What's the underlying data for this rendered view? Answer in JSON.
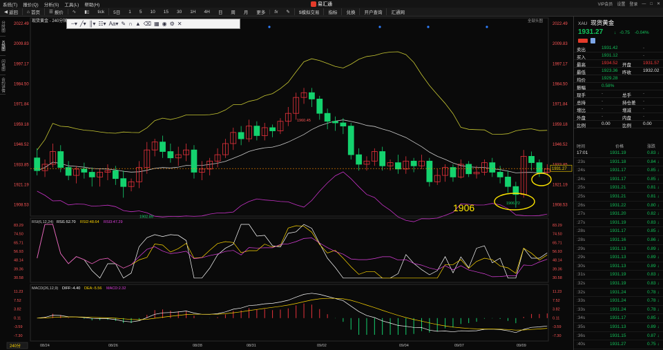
{
  "menu": [
    "系统(T)",
    "报价(Q)",
    "分析(S)",
    "工具(L)",
    "帮助(H)"
  ],
  "app_title": "易汇通",
  "window_right": [
    "VIP会员",
    "设置",
    "登录"
  ],
  "toolbar": {
    "back": "返回",
    "home": "首页",
    "quote": "报价",
    "minute": "分时",
    "tick": "tick",
    "periods": [
      "5日",
      "1",
      "5",
      "10",
      "15",
      "30",
      "1H",
      "4H",
      "日",
      "周",
      "月"
    ],
    "more": "更多",
    "fx": "fx",
    "sim_trade": "$模拟交易",
    "indicators": "指标",
    "exchange_order": "兑换",
    "account_query": "开户查询",
    "hui_tong": "汇通网"
  },
  "left_tabs": [
    "分时图",
    "K线图",
    "闪电图",
    "合约详情"
  ],
  "chart": {
    "title": "现货黄金 - 240分钟",
    "view_all": "全部头图",
    "price_scale": [
      "2022.49",
      "2009.83",
      "1997.17",
      "1984.50",
      "1971.84",
      "1959.18",
      "1946.52",
      "1933.85",
      "1921.19",
      "1908.53"
    ],
    "current_price": "1931.27",
    "high_label": "1960.45",
    "low_label": "1902.89",
    "low2_label": "1906.72",
    "annotation": "1906",
    "dates": [
      "08/24",
      "08/26",
      "08/28",
      "08/31",
      "09/02",
      "09/04",
      "09/07",
      "09/09"
    ],
    "rsi_title": "RSI(6,12,24)",
    "rsi_vals": [
      "RSI1:52.70",
      "RSI2:48.64",
      "RSI3:47.29"
    ],
    "rsi_scale": [
      "83.29",
      "74.50",
      "65.71",
      "56.93",
      "48.14",
      "39.36",
      "30.58"
    ],
    "macd_title": "MACD(26,12,9)",
    "macd_vals": [
      "DIFF:-4.40",
      "DEA:-5.56",
      "MACD:2.32"
    ],
    "macd_scale": [
      "11.23",
      "7.52",
      "3.82",
      "0.11",
      "-3.59",
      "-7.30"
    ],
    "period_tag": "240分"
  },
  "chart_data": {
    "type": "candlestick",
    "candles": [
      [
        1938,
        1930,
        1944,
        1927
      ],
      [
        1930,
        1934,
        1937,
        1926
      ],
      [
        1934,
        1942,
        1947,
        1932
      ],
      [
        1942,
        1932,
        1946,
        1929
      ],
      [
        1932,
        1927,
        1936,
        1924
      ],
      [
        1927,
        1931,
        1933,
        1922
      ],
      [
        1931,
        1929,
        1935,
        1925
      ],
      [
        1929,
        1926,
        1932,
        1920
      ],
      [
        1926,
        1929,
        1931,
        1920
      ],
      [
        1929,
        1930,
        1934,
        1924
      ],
      [
        1930,
        1925,
        1933,
        1921
      ],
      [
        1925,
        1920,
        1930,
        1913
      ],
      [
        1920,
        1923,
        1925,
        1917
      ],
      [
        1923,
        1932,
        1936,
        1919
      ],
      [
        1932,
        1943,
        1948,
        1928
      ],
      [
        1943,
        1948,
        1950,
        1939
      ],
      [
        1948,
        1942,
        1952,
        1938
      ],
      [
        1942,
        1938,
        1947,
        1935
      ],
      [
        1938,
        1940,
        1945,
        1933
      ],
      [
        1940,
        1943,
        1947,
        1936
      ],
      [
        1943,
        1929,
        1946,
        1925
      ],
      [
        1929,
        1931,
        1936,
        1924
      ],
      [
        1931,
        1936,
        1938,
        1927
      ],
      [
        1936,
        1940,
        1944,
        1932
      ],
      [
        1940,
        1947,
        1950,
        1938
      ],
      [
        1947,
        1954,
        1957,
        1943
      ],
      [
        1954,
        1950,
        1958,
        1946
      ],
      [
        1950,
        1958,
        1962,
        1948
      ],
      [
        1958,
        1952,
        1961,
        1949
      ],
      [
        1952,
        1957,
        1960,
        1949
      ],
      [
        1957,
        1955,
        1959,
        1951
      ],
      [
        1955,
        1961,
        1963,
        1953
      ],
      [
        1961,
        1966,
        1970,
        1958
      ],
      [
        1966,
        1976,
        1979,
        1962
      ],
      [
        1976,
        1979,
        1982,
        1972
      ],
      [
        1979,
        1975,
        1982,
        1970
      ],
      [
        1975,
        1966,
        1977,
        1962
      ],
      [
        1966,
        1961,
        1969,
        1956
      ],
      [
        1961,
        1960,
        1964,
        1955
      ],
      [
        1960,
        1958,
        1963,
        1953
      ],
      [
        1958,
        1940,
        1960,
        1937
      ],
      [
        1940,
        1934,
        1944,
        1930
      ],
      [
        1934,
        1936,
        1939,
        1930
      ],
      [
        1936,
        1942,
        1944,
        1933
      ],
      [
        1942,
        1933,
        1945,
        1930
      ],
      [
        1933,
        1935,
        1937,
        1930
      ],
      [
        1935,
        1931,
        1940,
        1928
      ],
      [
        1931,
        1936,
        1939,
        1928
      ],
      [
        1936,
        1933,
        1938,
        1929
      ],
      [
        1933,
        1936,
        1940,
        1931
      ],
      [
        1936,
        1923,
        1938,
        1920
      ],
      [
        1923,
        1927,
        1931,
        1921
      ],
      [
        1927,
        1932,
        1934,
        1923
      ],
      [
        1932,
        1926,
        1934,
        1923
      ],
      [
        1926,
        1934,
        1937,
        1925
      ],
      [
        1934,
        1928,
        1936,
        1926
      ],
      [
        1928,
        1929,
        1933,
        1925
      ],
      [
        1929,
        1935,
        1937,
        1927
      ],
      [
        1935,
        1929,
        1938,
        1926
      ],
      [
        1929,
        1926,
        1933,
        1922
      ],
      [
        1926,
        1920,
        1930,
        1916
      ],
      [
        1920,
        1915,
        1923,
        1906.72
      ],
      [
        1915,
        1939,
        1943,
        1913
      ],
      [
        1939,
        1935,
        1942,
        1930
      ],
      [
        1935,
        1929,
        1937,
        1926
      ],
      [
        1929,
        1931,
        1934,
        1927
      ]
    ],
    "current": 1931.27,
    "high": 1960.45,
    "low": 1902.89
  },
  "side": {
    "code": "XAU",
    "name": "现货黄金",
    "price": "1931.27",
    "change": "-0.75",
    "change_pct": "-0.04%",
    "quotes": [
      {
        "label": "卖出",
        "value": "1931.42",
        "c": "green",
        "l2": "",
        "v2": "-"
      },
      {
        "label": "买入",
        "value": "1931.12",
        "c": "green",
        "l2": "",
        "v2": "-"
      },
      {
        "label": "最高",
        "value": "1934.52",
        "c": "red",
        "l2": "开盘",
        "v2": "1931.57"
      },
      {
        "label": "最低",
        "value": "1923.36",
        "c": "green",
        "l2": "昨收",
        "v2": "1932.02"
      },
      {
        "label": "均价",
        "value": "1929.28",
        "c": "green",
        "l2": "",
        "v2": ""
      },
      {
        "label": "振幅",
        "value": "0.58%",
        "c": "green",
        "l2": "",
        "v2": ""
      },
      {
        "label": "现手",
        "value": "-",
        "c": "gray",
        "l2": "总手",
        "v2": "-"
      },
      {
        "label": "总持",
        "value": "-",
        "c": "gray",
        "l2": "持仓差",
        "v2": "-"
      },
      {
        "label": "增比",
        "value": "-",
        "c": "gray",
        "l2": "增减",
        "v2": "-"
      },
      {
        "label": "外盘",
        "value": "-",
        "c": "gray",
        "l2": "内盘",
        "v2": "-"
      },
      {
        "label": "比例",
        "value": "0.00",
        "c": "white",
        "l2": "比例",
        "v2": "0.00"
      }
    ],
    "tick_headers": [
      "时间",
      "价格",
      "涨跌"
    ],
    "ticks": [
      {
        "t": "17:01",
        "p": "1931.19",
        "d": "0.83"
      },
      {
        "t": ":23s",
        "p": "1931.18",
        "d": "0.84"
      },
      {
        "t": ":24s",
        "p": "1931.17",
        "d": "0.85"
      },
      {
        "t": ":24s",
        "p": "1931.17",
        "d": "0.85"
      },
      {
        "t": ":25s",
        "p": "1931.21",
        "d": "0.81"
      },
      {
        "t": ":25s",
        "p": "1931.21",
        "d": "0.81"
      },
      {
        "t": ":26s",
        "p": "1931.22",
        "d": "0.80"
      },
      {
        "t": ":27s",
        "p": "1931.20",
        "d": "0.82"
      },
      {
        "t": ":27s",
        "p": "1931.19",
        "d": "0.83"
      },
      {
        "t": ":28s",
        "p": "1931.17",
        "d": "0.85"
      },
      {
        "t": ":28s",
        "p": "1931.16",
        "d": "0.86"
      },
      {
        "t": ":29s",
        "p": "1931.13",
        "d": "0.89"
      },
      {
        "t": ":29s",
        "p": "1931.13",
        "d": "0.89"
      },
      {
        "t": ":30s",
        "p": "1931.13",
        "d": "0.89"
      },
      {
        "t": ":31s",
        "p": "1931.19",
        "d": "0.83"
      },
      {
        "t": ":32s",
        "p": "1931.19",
        "d": "0.83"
      },
      {
        "t": ":32s",
        "p": "1931.24",
        "d": "0.78"
      },
      {
        "t": ":33s",
        "p": "1931.24",
        "d": "0.78"
      },
      {
        "t": ":33s",
        "p": "1931.24",
        "d": "0.78"
      },
      {
        "t": ":34s",
        "p": "1931.17",
        "d": "0.85"
      },
      {
        "t": ":35s",
        "p": "1931.13",
        "d": "0.89"
      },
      {
        "t": ":36s",
        "p": "1931.15",
        "d": "0.87"
      },
      {
        "t": ":40s",
        "p": "1931.27",
        "d": "0.75"
      }
    ]
  }
}
